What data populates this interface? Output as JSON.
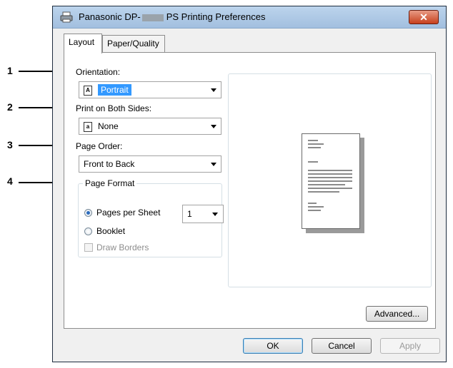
{
  "window": {
    "title_prefix": "Panasonic DP-",
    "title_suffix": "PS Printing Preferences",
    "close_glyph": "✕"
  },
  "tabs": [
    {
      "label": "Layout"
    },
    {
      "label": "Paper/Quality"
    }
  ],
  "callouts": [
    "1",
    "2",
    "3",
    "4"
  ],
  "orientation": {
    "label": "Orientation:",
    "value": "Portrait",
    "icon": "A"
  },
  "duplex": {
    "label": "Print on Both Sides:",
    "value": "None",
    "icon": "a"
  },
  "page_order": {
    "label": "Page Order:",
    "value": "Front to Back"
  },
  "page_format": {
    "title": "Page Format",
    "pages_per_sheet_label": "Pages per Sheet",
    "pages_per_sheet_value": "1",
    "booklet_label": "Booklet",
    "draw_borders_label": "Draw Borders"
  },
  "buttons": {
    "advanced": "Advanced...",
    "ok": "OK",
    "cancel": "Cancel",
    "apply": "Apply"
  }
}
